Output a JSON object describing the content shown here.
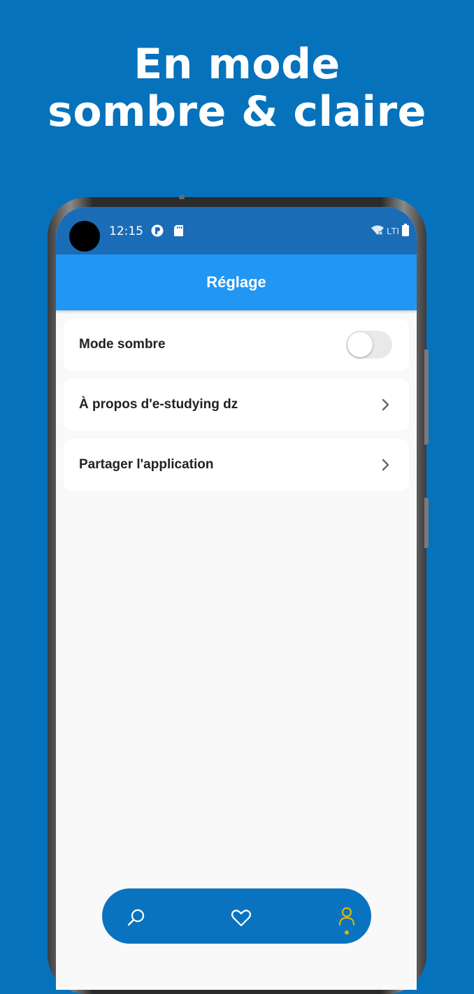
{
  "promo": {
    "title_line1": "En mode",
    "title_line2": "sombre & claire"
  },
  "status_bar": {
    "time": "12:15",
    "network": "LTI",
    "icons": [
      "app-notification-icon",
      "sd-card-icon",
      "wifi-off-icon",
      "battery-icon"
    ]
  },
  "app_bar": {
    "title": "Réglage"
  },
  "settings": {
    "items": [
      {
        "label": "Mode sombre",
        "control": "toggle",
        "enabled": false
      },
      {
        "label": "À propos d'e-studying dz",
        "control": "chevron-right-icon"
      },
      {
        "label": "Partager l'application",
        "control": "chevron-right-icon"
      }
    ]
  },
  "bottom_nav": {
    "items": [
      {
        "icon": "search-icon",
        "active": false
      },
      {
        "icon": "heart-icon",
        "active": false
      },
      {
        "icon": "profile-icon",
        "active": true
      }
    ]
  },
  "colors": {
    "background": "#0672bc",
    "status_bar": "#1b6cb7",
    "app_bar": "#2196f3",
    "screen": "#f9f9f9",
    "bottom_nav": "#0a73c0",
    "active_nav": "#e0b400"
  }
}
